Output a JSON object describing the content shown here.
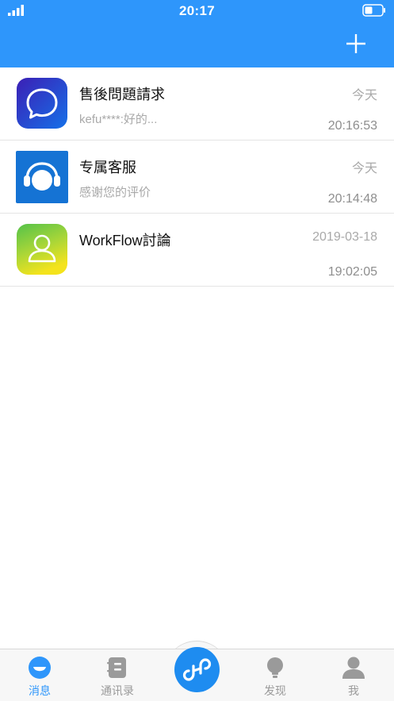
{
  "status_bar": {
    "time": "20:17"
  },
  "header": {
    "add_icon": "plus-icon"
  },
  "conversations": [
    {
      "title": "售後問題請求",
      "preview": "kefu****:好的...",
      "date": "今天",
      "time": "20:16:53",
      "icon": "chat-bubble-icon"
    },
    {
      "title": "专属客服",
      "preview": "感谢您的评价",
      "date": "今天",
      "time": "20:14:48",
      "icon": "headset-icon"
    },
    {
      "title": "WorkFlow討論",
      "preview": "",
      "date": "2019-03-18",
      "time": "19:02:05",
      "icon": "user-icon"
    }
  ],
  "tabbar": {
    "tabs": [
      {
        "label": "消息",
        "icon": "message-icon",
        "active": true
      },
      {
        "label": "通讯录",
        "icon": "contacts-icon",
        "active": false
      },
      {
        "label": "",
        "icon": "link-icon",
        "active": false
      },
      {
        "label": "发现",
        "icon": "lightbulb-icon",
        "active": false
      },
      {
        "label": "我",
        "icon": "profile-icon",
        "active": false
      }
    ]
  },
  "colors": {
    "primary": "#2e96fb",
    "center_button": "#1e8cf0",
    "inactive_tab": "#9a9a9a"
  }
}
